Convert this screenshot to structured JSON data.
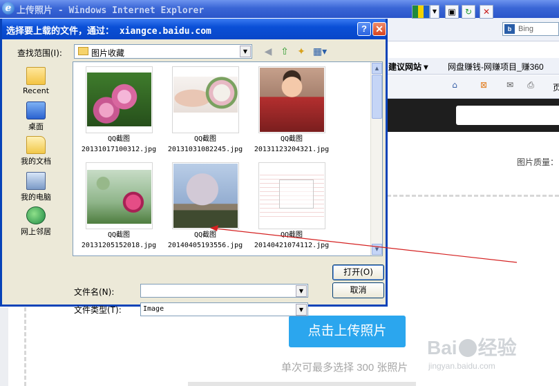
{
  "ie": {
    "title": "上传照片 - Windows Internet Explorer",
    "search_placeholder": "Bing",
    "favorites": [
      "建议网站 ▾",
      "网盘赚钱-网赚项目_赚360"
    ],
    "cmd_more": "页"
  },
  "page": {
    "quality_label": "图片质量：",
    "upload_button": "点击上传照片",
    "upload_note": "单次可最多选择 300 张照片",
    "watermark": "Baidu经验",
    "watermark_url": "jingyan.baidu.com"
  },
  "dialog": {
    "title": "选择要上载的文件，通过： xiangce.baidu.com",
    "help": "?",
    "close": "✕",
    "look_in_label": "查找范围(I):",
    "look_in_value": "图片收藏",
    "places": [
      "Recent",
      "桌面",
      "我的文档",
      "我的电脑",
      "网上邻居"
    ],
    "files": [
      {
        "line1": "QQ截图",
        "line2": "20131017100312.jpg"
      },
      {
        "line1": "QQ截图",
        "line2": "20131031082245.jpg"
      },
      {
        "line1": "QQ截图",
        "line2": "20131123204321.jpg"
      },
      {
        "line1": "QQ截图",
        "line2": "20131205152018.jpg"
      },
      {
        "line1": "QQ截图",
        "line2": "20140405193556.jpg"
      },
      {
        "line1": "QQ截图",
        "line2": "20140421074112.jpg"
      }
    ],
    "file_name_label": "文件名(N):",
    "file_name_value": "",
    "file_type_label": "文件类型(T):",
    "file_type_value": "Image",
    "open_button": "打开(O)",
    "cancel_button": "取消"
  },
  "colors": {
    "dialog_title_bg": "#0a4fd6",
    "upload_button": "#2ba6ee",
    "annotation": "#d42020"
  }
}
